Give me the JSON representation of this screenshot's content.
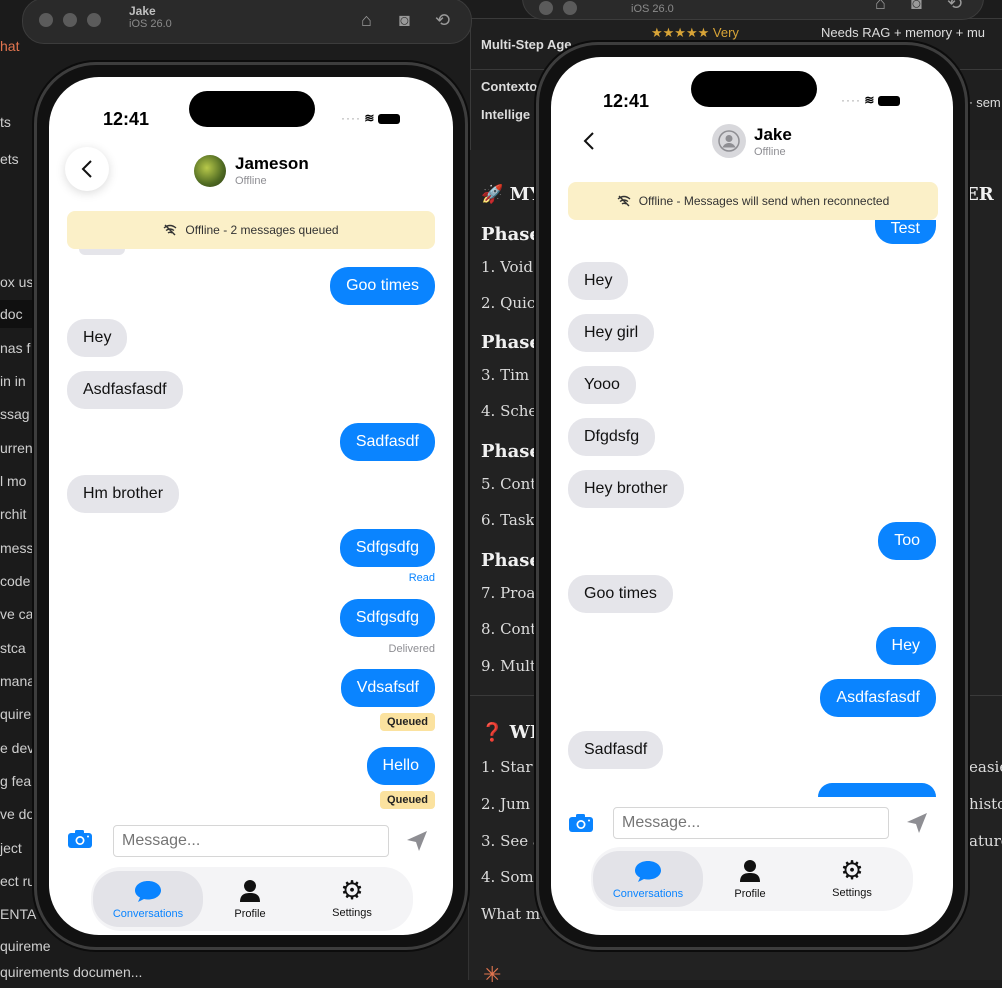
{
  "background": {
    "sim_left": {
      "name": "Jake",
      "version": "iOS 26.0"
    },
    "sim_right": {
      "version": "iOS 26.0"
    },
    "sidebar_items": [
      "hat",
      "ts",
      "ets",
      "ox us",
      "doc",
      "nas f",
      "in in",
      "ssag",
      "urren",
      "l mo",
      "rchit",
      "mess",
      "code",
      "ve ca",
      "stca",
      "mana",
      "quire",
      "e dev",
      "g fea",
      "ve do",
      "ject",
      "ect ru",
      "ENTA",
      "quireme",
      "quirements documen..."
    ],
    "table": {
      "row1_label": "Multi-Step Age",
      "row1_col2": "★★★★★ Very",
      "row1_col3": "Needs RAG + memory + mu",
      "row2_label": "Contexto",
      "row3_label": "Intellige",
      "row2_col3": "+ sem"
    },
    "doc_lines": [
      "🚀 MY",
      "ER",
      "Phase",
      "1. Void",
      "2. Quic",
      "Phase",
      "3. Tim",
      "4. Sche",
      "Phase",
      "5. Cont",
      "6. Task",
      "Phase",
      "7. Proa",
      "8. Cont",
      "9. Mult",
      "❓ WH",
      "1. Star",
      "easie",
      "2. Jum",
      "histo",
      "3. See a",
      "ature",
      "4. Som",
      "What ma"
    ]
  },
  "phone_left": {
    "time": "12:41",
    "contact": {
      "name": "Jameson",
      "status": "Offline"
    },
    "banner": "Offline - 2 messages queued",
    "messages": [
      {
        "dir": "out",
        "text": "Goo times"
      },
      {
        "dir": "in",
        "text": "Hey"
      },
      {
        "dir": "in",
        "text": "Asdfasfasdf"
      },
      {
        "dir": "out",
        "text": "Sadfasdf"
      },
      {
        "dir": "in",
        "text": "Hm brother"
      },
      {
        "dir": "out",
        "text": "Sdfgsdfg",
        "meta": "Read"
      },
      {
        "dir": "out",
        "text": "Sdfgsdfg",
        "meta": "Delivered"
      },
      {
        "dir": "out",
        "text": "Vdsafsdf",
        "queued": "Queued"
      },
      {
        "dir": "out",
        "text": "Hello",
        "queued": "Queued"
      }
    ],
    "composer_placeholder": "Message...",
    "tabs": [
      "Conversations",
      "Profile",
      "Settings"
    ]
  },
  "phone_right": {
    "time": "12:41",
    "contact": {
      "name": "Jake",
      "status": "Offline"
    },
    "banner": "Offline - Messages will send when reconnected",
    "messages": [
      {
        "dir": "out",
        "text": "Test"
      },
      {
        "dir": "in",
        "text": "Hey"
      },
      {
        "dir": "in",
        "text": "Hey girl"
      },
      {
        "dir": "in",
        "text": "Yooo"
      },
      {
        "dir": "in",
        "text": "Dfgdsfg"
      },
      {
        "dir": "in",
        "text": "Hey brother"
      },
      {
        "dir": "out",
        "text": "Too"
      },
      {
        "dir": "in",
        "text": "Goo times"
      },
      {
        "dir": "out",
        "text": "Hey"
      },
      {
        "dir": "out",
        "text": "Asdfasfasdf"
      },
      {
        "dir": "in",
        "text": "Sadfasdf"
      }
    ],
    "composer_placeholder": "Message...",
    "tabs": [
      "Conversations",
      "Profile",
      "Settings"
    ]
  },
  "colors": {
    "accent": "#0a84ff",
    "incoming": "#e5e5ea",
    "banner": "#fbf0c8",
    "queued": "#fbe29f"
  }
}
